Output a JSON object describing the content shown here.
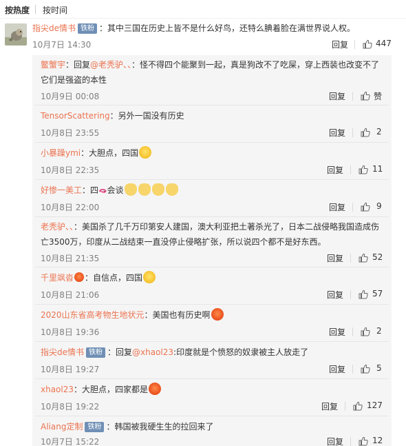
{
  "sort": {
    "hot": "按热度",
    "time": "按时间"
  },
  "main_comment": {
    "author": "指尖de情书",
    "badge": "铁粉",
    "text": "：其中三国在历史上皆不是什么好鸟，还特么腆着脸在满世界说人权。",
    "time": "10月7日 14:30",
    "reply_label": "回复",
    "likes": "447"
  },
  "replies": [
    {
      "author": "鳖蟹宇",
      "text_prefix": "：回复",
      "mention": "@老秃驴、、",
      "text": "：怪不得四个能聚到一起，真是狗改不了吃屎，穿上西装也改变不了它们是强盗的本性",
      "time": "10月9日 00:08",
      "reply_label": "回复",
      "likes": "赞"
    },
    {
      "author": "TensorScattering",
      "text": "：另外一国没有历史",
      "time": "10月8日 23:55",
      "reply_label": "回复",
      "likes": "2"
    },
    {
      "author": "小暴躁ymi",
      "text": "：大胆点，四国",
      "emoji": "smile-emoji",
      "time": "10月8日 22:35",
      "reply_label": "回复",
      "likes": "11"
    },
    {
      "author": "好惨一美工",
      "text": "：四",
      "text2": "会谈",
      "emoji": "cat-emoji",
      "time": "10月8日 22:00",
      "reply_label": "回复",
      "likes": "9"
    },
    {
      "author": "老秃驴、、",
      "text": "：美国杀了几千万印第安人建国，澳大利亚把土著杀光了，日本二战侵略我国造成伤亡3500万，印度从二战结束一直没停止侵略扩张，所以说四个都不是好东西。",
      "time": "10月8日 21:35",
      "reply_label": "回复",
      "likes": "52"
    },
    {
      "author": "千里飒沓",
      "text": "：自信点，四国",
      "emoji": "glasses-emoji",
      "time": "10月8日 21:06",
      "reply_label": "回复",
      "likes": "57"
    },
    {
      "author": "2020山东省高考物生地状元",
      "text": "：美国也有历史啊",
      "emoji": "angry-emoji",
      "time": "10月8日 19:36",
      "reply_label": "回复",
      "likes": "2"
    },
    {
      "author": "指尖de情书",
      "badge": "铁粉",
      "text_prefix": "：回复",
      "mention": "@xhaol23",
      "text": ":印度就是个愤怒的奴隶被主人放走了",
      "time": "10月8日 19:27",
      "reply_label": "回复",
      "likes": "5"
    },
    {
      "author": "xhaol23",
      "text": "：大胆点，四家都是",
      "emoji": "red-face-emoji",
      "time": "10月8日 19:22",
      "reply_label": "回复",
      "likes": "127"
    },
    {
      "author": "Aliang定制",
      "badge": "铁粉",
      "text": "：韩国被我硬生生的拉回来了",
      "time": "10月7日 15:22",
      "reply_label": "回复",
      "likes": "12"
    }
  ]
}
